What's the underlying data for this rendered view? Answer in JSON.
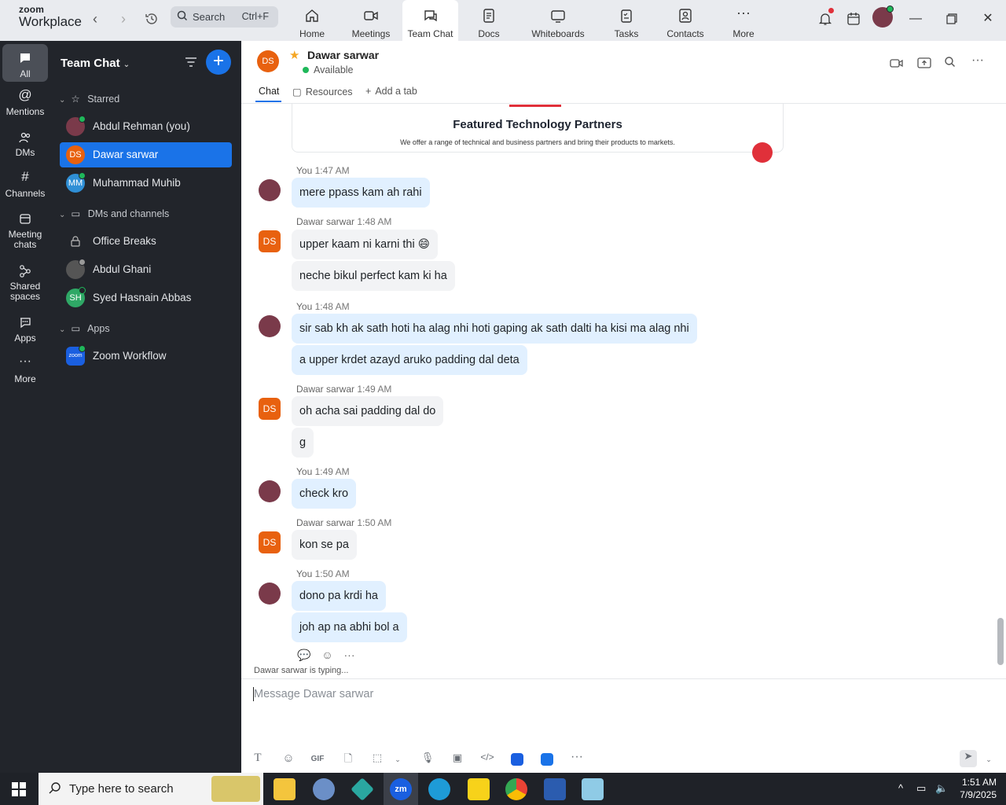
{
  "app": {
    "logo_line1": "zoom",
    "logo_line2": "Workplace"
  },
  "topbar": {
    "search_label": "Search",
    "search_shortcut": "Ctrl+F",
    "tabs": [
      {
        "label": "Home",
        "icon": "home-icon"
      },
      {
        "label": "Meetings",
        "icon": "video-camera-icon"
      },
      {
        "label": "Team Chat",
        "icon": "chat-icon",
        "active": true
      },
      {
        "label": "Docs",
        "icon": "document-icon"
      },
      {
        "label": "Whiteboards",
        "icon": "whiteboard-icon"
      },
      {
        "label": "Tasks",
        "icon": "tasks-icon"
      },
      {
        "label": "Contacts",
        "icon": "contacts-icon"
      },
      {
        "label": "More",
        "icon": "more-dots-icon"
      }
    ]
  },
  "rail": {
    "items": [
      {
        "label": "All",
        "icon": "chat-bubble-icon",
        "active": true
      },
      {
        "label": "Mentions",
        "icon": "at-sign-icon"
      },
      {
        "label": "DMs",
        "icon": "people-icon"
      },
      {
        "label": "Channels",
        "icon": "hash-icon"
      },
      {
        "label": "Meeting chats",
        "icon": "calendar-icon"
      },
      {
        "label": "Shared spaces",
        "icon": "shared-spaces-icon"
      },
      {
        "label": "Apps",
        "icon": "apps-icon"
      },
      {
        "label": "More",
        "icon": "more-dots-icon"
      }
    ]
  },
  "sidebar": {
    "title": "Team Chat",
    "sections": {
      "starred": "Starred",
      "dms_channels": "DMs and channels",
      "apps": "Apps"
    },
    "starred_contacts": [
      {
        "name": "Abdul Rehman (you)",
        "initials": ""
      },
      {
        "name": "Dawar sarwar",
        "initials": "DS",
        "active": true
      },
      {
        "name": "Muhammad Muhib",
        "initials": "MM"
      }
    ],
    "dm_contacts": [
      {
        "name": "Office Breaks",
        "initials": ""
      },
      {
        "name": "Abdul Ghani",
        "initials": ""
      },
      {
        "name": "Syed Hasnain Abbas",
        "initials": "SH"
      }
    ],
    "apps": [
      {
        "name": "Zoom Workflow",
        "initials": "zoom"
      }
    ]
  },
  "chat_header": {
    "initials": "DS",
    "name": "Dawar sarwar",
    "status": "Available",
    "tabs": [
      "Chat",
      "Resources",
      "Add a tab"
    ]
  },
  "card": {
    "title": "Featured Technology Partners",
    "subtitle": "We offer a range of technical and business partners and bring their products to markets."
  },
  "messages": [
    {
      "sender": "You",
      "time": "1:47 AM",
      "self": true,
      "texts": [
        "mere ppass kam ah rahi"
      ]
    },
    {
      "sender": "Dawar sarwar",
      "time": "1:48 AM",
      "self": false,
      "texts": [
        "upper kaam ni karni thi 😄",
        "neche bikul perfect kam ki ha"
      ]
    },
    {
      "sender": "You",
      "time": "1:48 AM",
      "self": true,
      "texts": [
        "sir sab kh ak sath hoti ha alag nhi hoti gaping ak sath dalti ha kisi ma alag nhi",
        "a upper krdet azayd aruko padding dal deta"
      ]
    },
    {
      "sender": "Dawar sarwar",
      "time": "1:49 AM",
      "self": false,
      "texts": [
        "oh acha sai padding dal do",
        "g"
      ]
    },
    {
      "sender": "You",
      "time": "1:49 AM",
      "self": true,
      "texts": [
        "check kro"
      ]
    },
    {
      "sender": "Dawar sarwar",
      "time": "1:50 AM",
      "self": false,
      "texts": [
        "kon se pa"
      ]
    },
    {
      "sender": "You",
      "time": "1:50 AM",
      "self": true,
      "texts": [
        "dono pa krdi ha",
        "joh ap na abhi bol a"
      ]
    }
  ],
  "typing_indicator": "Dawar sarwar  is typing...",
  "composer": {
    "placeholder": "Message Dawar sarwar",
    "gif_label": "GIF"
  },
  "taskbar": {
    "search_placeholder": "Type here to search",
    "time": "1:51 AM",
    "date": "7/9/2025"
  },
  "colors": {
    "accent": "#1a73e8",
    "sidebar_bg": "#22252b",
    "self_bubble": "#e1f0ff",
    "other_bubble": "#f2f3f5",
    "avatar_orange": "#e8610f",
    "online": "#1fb85a"
  }
}
